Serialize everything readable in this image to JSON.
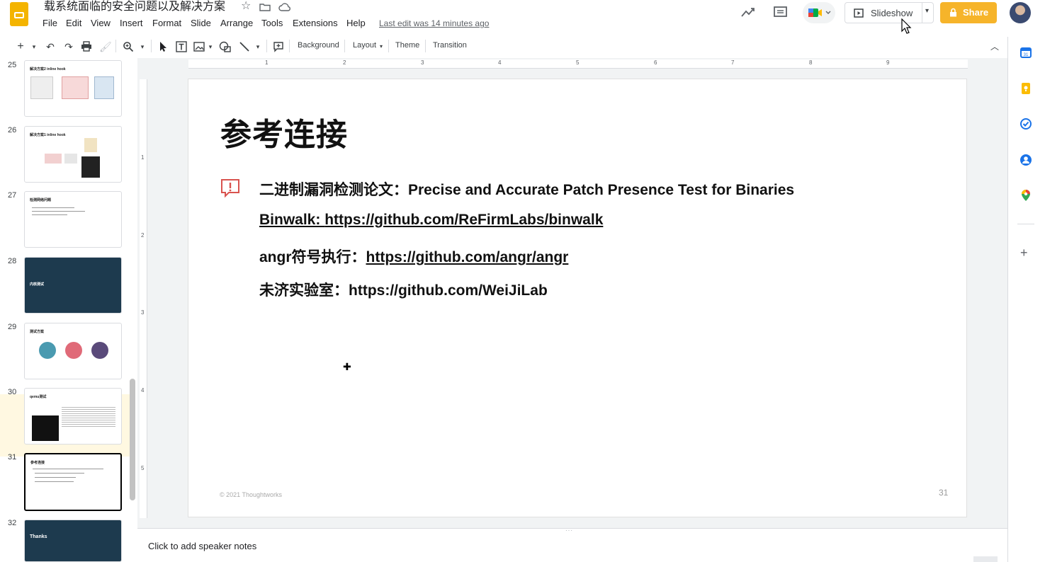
{
  "app": {
    "document_title": "载系统面临的安全问题以及解决方案",
    "last_edit": "Last edit was 14 minutes ago",
    "menu": [
      "File",
      "Edit",
      "View",
      "Insert",
      "Format",
      "Slide",
      "Arrange",
      "Tools",
      "Extensions",
      "Help"
    ],
    "header_buttons": {
      "slideshow": "Slideshow",
      "share": "Share"
    },
    "icons": [
      "star-icon",
      "move-to-folder-icon",
      "cloud-saved-icon",
      "activity-trend-icon",
      "comments-icon",
      "google-meet-icon",
      "avatar"
    ]
  },
  "toolbar": {
    "background": "Background",
    "layout": "Layout",
    "theme": "Theme",
    "transition": "Transition"
  },
  "ruler": {
    "horizontal_marks": [
      "1",
      "2",
      "3",
      "4",
      "5",
      "6",
      "7",
      "8",
      "9"
    ],
    "vertical_marks": [
      "1",
      "2",
      "3",
      "4",
      "5"
    ]
  },
  "filmstrip": [
    {
      "number": "25",
      "title": "解决方案2 inline hook"
    },
    {
      "number": "26",
      "title": "解决方案1 inline hook"
    },
    {
      "number": "27",
      "title": "检测网络问题"
    },
    {
      "number": "28",
      "title": "内核测试"
    },
    {
      "number": "29",
      "title": "测试方案"
    },
    {
      "number": "30",
      "title": "qemu测试"
    },
    {
      "number": "31",
      "title": "参考连接"
    },
    {
      "number": "32",
      "title": "Thanks"
    }
  ],
  "slide": {
    "title": "参考连接",
    "lines": {
      "paper": "二进制漏洞检测论文：Precise and Accurate Patch Presence Test for Binaries",
      "binwalk_prefix": "Binwalk: ",
      "binwalk_url": "https://github.com/ReFirmLabs/binwalk",
      "angr_prefix": "angr符号执行：",
      "angr_url": "https://github.com/angr/angr",
      "weiji": "未济实验室：https://github.com/WeiJiLab"
    },
    "footer": "© 2021 Thoughtworks",
    "page_number": "31"
  },
  "speaker_notes_placeholder": "Click to add speaker notes",
  "colors": {
    "brand_yellow": "#f4b400",
    "share_button": "#f6b42a",
    "dark_slide": "#1d3a4e",
    "alert_red": "#d9534f"
  }
}
